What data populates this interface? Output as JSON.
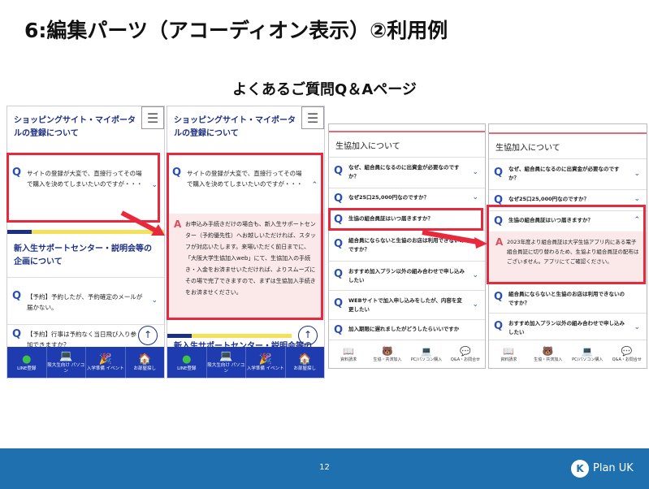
{
  "slide": {
    "title": "6:編集パーツ（アコーディオン表示）②利用例",
    "subtitle": "よくあるご質問Q＆Aページ",
    "page_number": "12",
    "logo_text": "Plan UK"
  },
  "colors": {
    "footer": "#1f70ae",
    "highlight_red": "#e8283c",
    "navy": "#1b2f84",
    "answer_bg": "#fbe9ea"
  },
  "phone1": {
    "section1_title": "ショッピングサイト・マイポータルの登録について",
    "q1": "サイトの登録が大変で、直接行ってその場で購入を決めてしまいたいのですが・・・",
    "section2_title": "新入生サポートセンター・説明会等の企画について",
    "q2": "【予約】予約したが、予約確定のメールが届かない。",
    "q3": "【予約】行事は予約なく当日飛び入り参加できますか？"
  },
  "phone2": {
    "section1_title": "ショッピングサイト・マイポータルの登録について",
    "q1": "サイトの登録が大変で、直接行ってその場で購入を決めてしまいたいのですが・・・",
    "a1": "お申込み手続きだけの場合も、新入生サポートセンター（予約優先性）へお越しいただければ、スタッフが対応いたします。来場いただく前日までに、「大阪大学生協加入web」にて、生協加入の手続き・入金をお済ませいただければ、よりスムーズにその場で完了できますので、まずは生協加入手続きをお済ませください。",
    "section2_partial": "新入生サポートセンター・説明会等の"
  },
  "bottom_nav_blue": [
    {
      "icon": "LINE",
      "label": "LINE登録"
    },
    {
      "icon": "💻",
      "label": "阪大生向け パソコン"
    },
    {
      "icon": "🎉",
      "label": "入学準備 イベント"
    },
    {
      "icon": "🏠",
      "label": "お部屋探し"
    }
  ],
  "phone3": {
    "section_title": "生協加入について",
    "q1": "なぜ、組合員になるのに出資金が必要なのですか？",
    "q2": "なぜ25口25,000円なのですか？",
    "q3": "生協の組合員証はいつ届きますか？",
    "q4": "組合員にならないと生協のお店は利用できないのですか？",
    "q5": "おすすめ加入プラン以外の組み合わせで申し込みしたい",
    "q6": "WEBサイトで加入申し込みをしたが、内容を変更したい",
    "q7": "加入期限に遅れましたがどうしたらいいですか"
  },
  "phone4": {
    "section_title": "生協加入について",
    "q1": "なぜ、組合員になるのに出資金が必要なのですか？",
    "q2": "なぜ25口25,000円なのですか？",
    "q3": "生協の組合員証はいつ届きますか？",
    "a3": "2023年度より組合員証は大学生協アプリ内にある電子組合員証に切り替わるため、生協より組合員証の配布はございません。アプリにてご確認ください。",
    "q4": "組合員にならないと生協のお店は利用できないのですか？",
    "q5": "おすすめ加入プラン以外の組み合わせで申し込みしたい"
  },
  "bottom_nav_white": [
    {
      "icon": "📖",
      "label": "資料請求"
    },
    {
      "icon": "🐻",
      "label": "生協・共済加入"
    },
    {
      "icon": "💻",
      "label": "PC/パソコン購入"
    },
    {
      "icon": "💬",
      "label": "Q&A・お問合せ"
    }
  ]
}
